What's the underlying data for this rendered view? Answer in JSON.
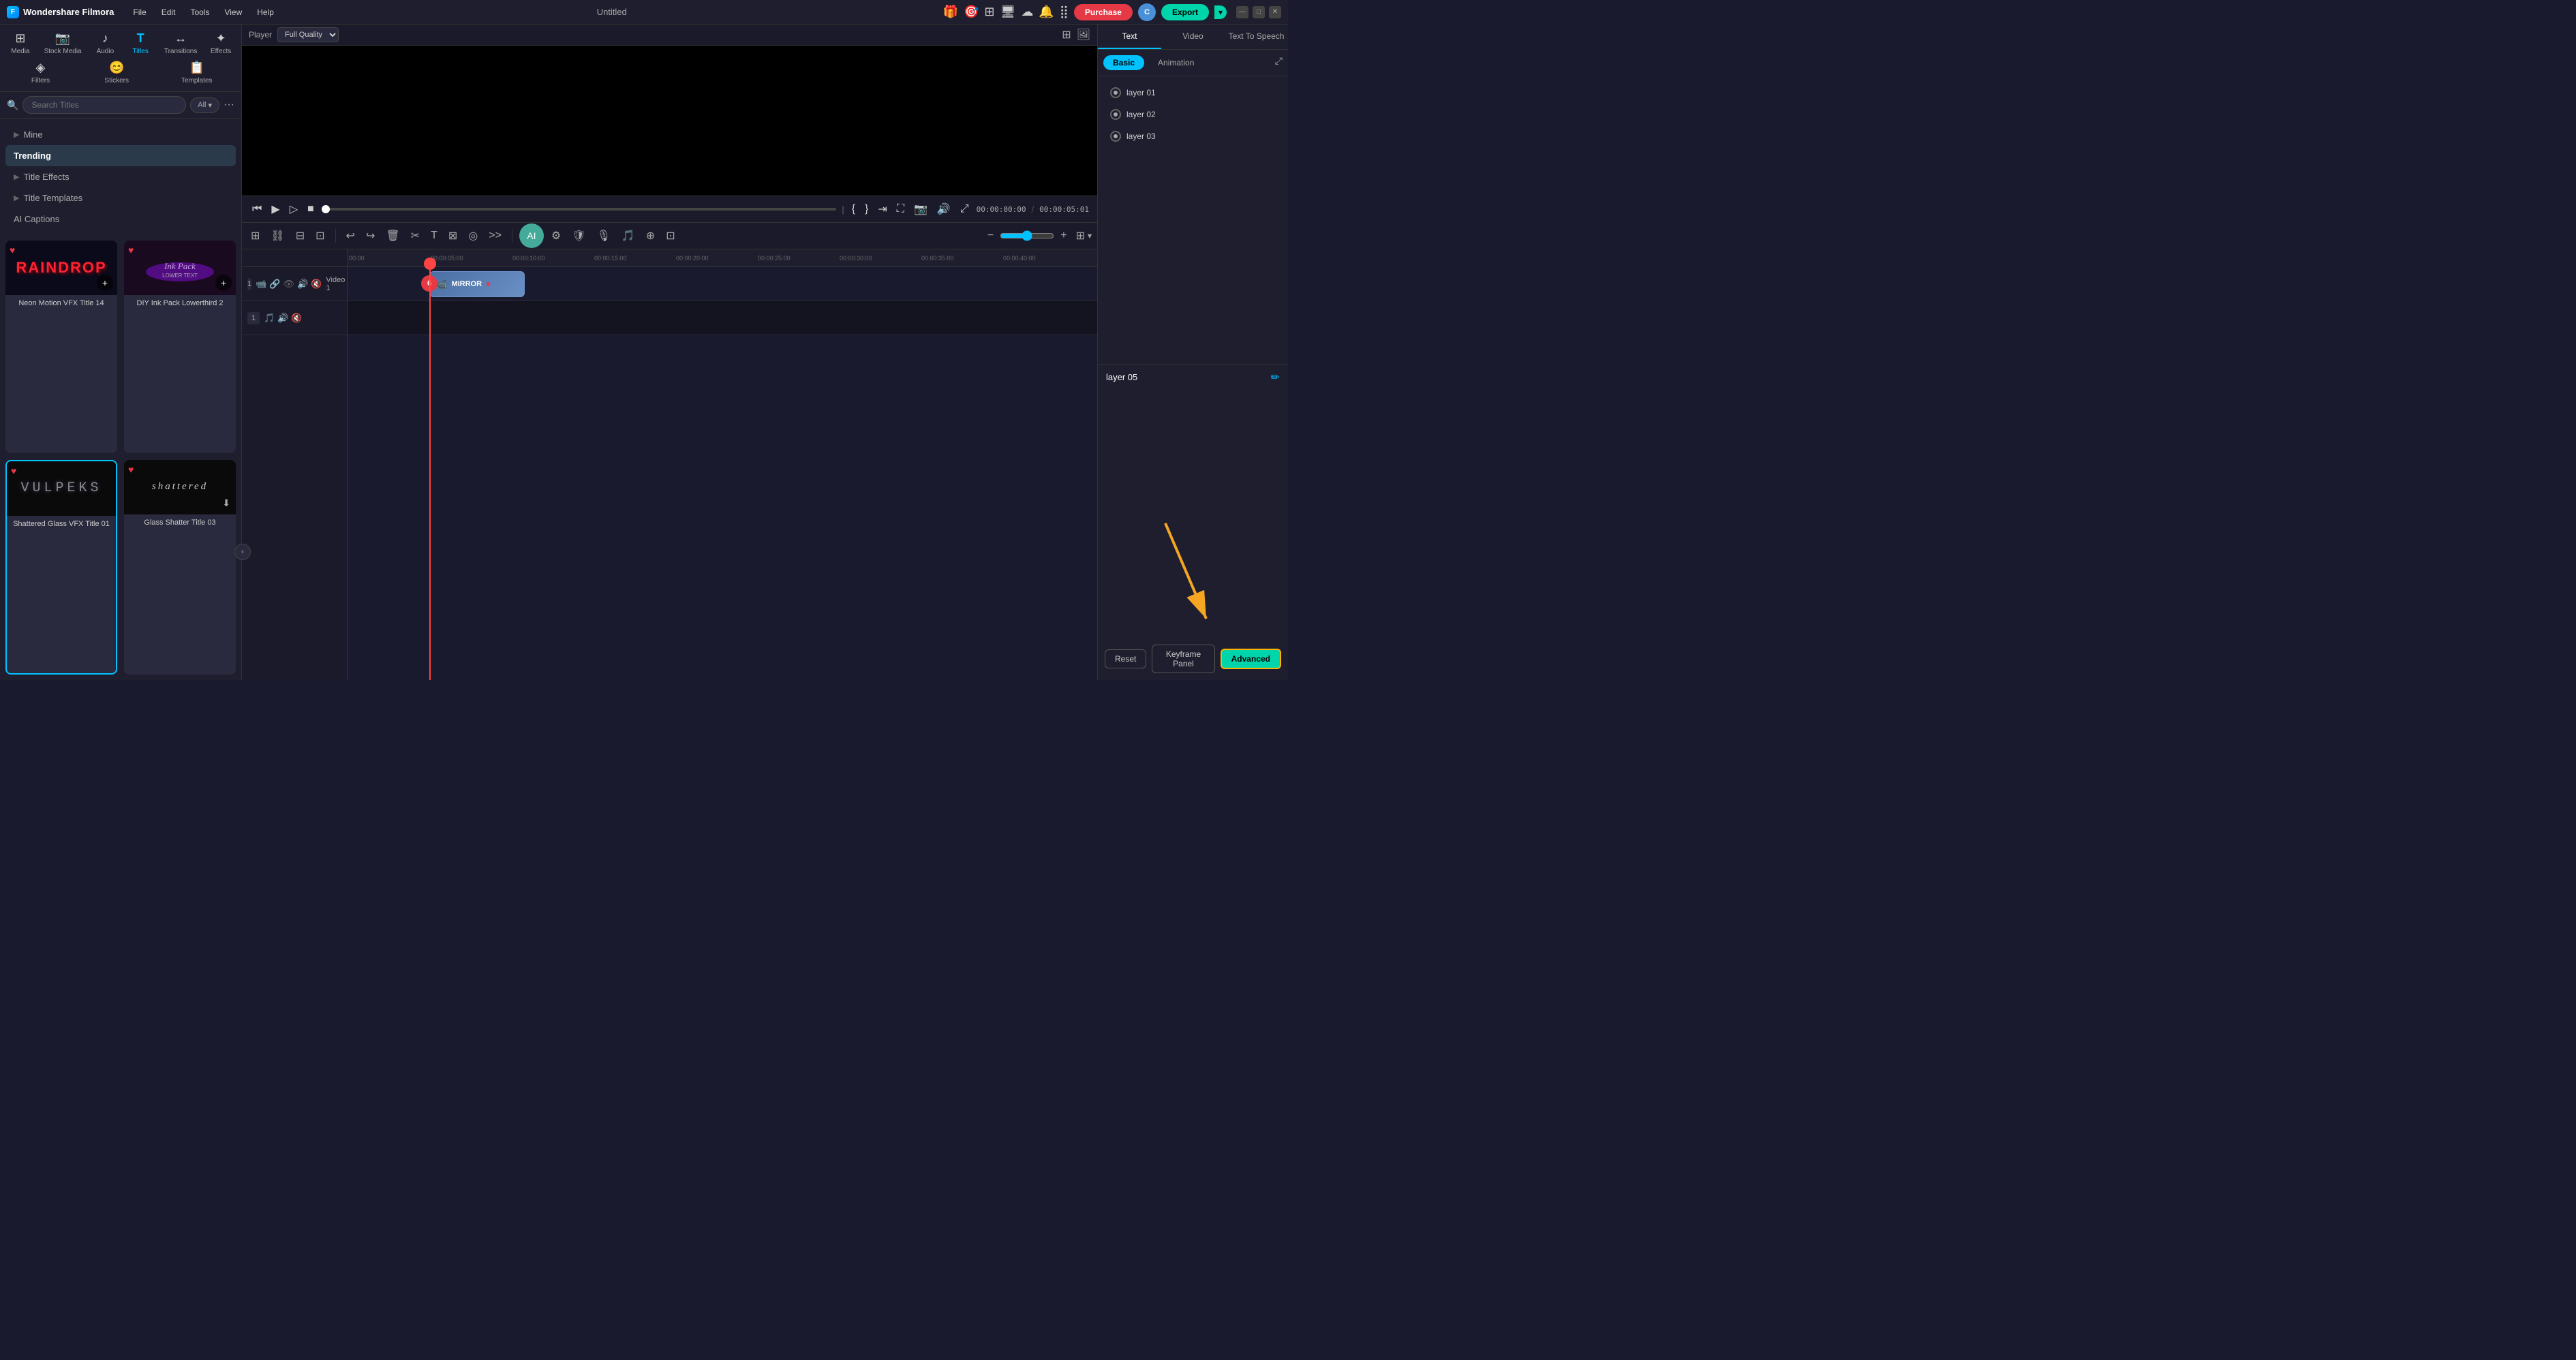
{
  "app": {
    "name": "Wondershare Filmora",
    "project_name": "Untitled"
  },
  "titlebar": {
    "nav_items": [
      "File",
      "Edit",
      "Tools",
      "View",
      "Help"
    ],
    "purchase_label": "Purchase",
    "export_label": "Export",
    "user_initial": "C"
  },
  "media_toolbar": {
    "items": [
      {
        "id": "media",
        "label": "Media",
        "icon": "⊞"
      },
      {
        "id": "stock",
        "label": "Stock Media",
        "icon": "📷"
      },
      {
        "id": "audio",
        "label": "Audio",
        "icon": "♪"
      },
      {
        "id": "titles",
        "label": "Titles",
        "icon": "T"
      },
      {
        "id": "transitions",
        "label": "Transitions",
        "icon": "↔"
      },
      {
        "id": "effects",
        "label": "Effects",
        "icon": "✦"
      },
      {
        "id": "filters",
        "label": "Filters",
        "icon": "◈"
      },
      {
        "id": "stickers",
        "label": "Stickers",
        "icon": "😊"
      },
      {
        "id": "templates",
        "label": "Templates",
        "icon": "📋"
      }
    ],
    "active": "titles"
  },
  "sidebar": {
    "items": [
      {
        "id": "mine",
        "label": "Mine",
        "expandable": true
      },
      {
        "id": "trending",
        "label": "Trending",
        "expandable": false,
        "active": true
      },
      {
        "id": "title-effects",
        "label": "Title Effects",
        "expandable": true
      },
      {
        "id": "title-templates",
        "label": "Title Templates",
        "expandable": true
      },
      {
        "id": "ai-captions",
        "label": "AI Captions",
        "expandable": false
      }
    ]
  },
  "search": {
    "placeholder": "Search Titles",
    "filter_label": "All",
    "icon": "🔍"
  },
  "thumbnails": [
    {
      "id": "thumb1",
      "title": "Neon Motion VFX Title 14",
      "has_heart": true,
      "style": "raindrop",
      "display_text": "RAINDROP",
      "selected": false
    },
    {
      "id": "thumb2",
      "title": "DIY Ink Pack Lowerthird 2",
      "has_heart": true,
      "style": "inkpack",
      "display_text": "Ink Pack",
      "selected": false
    },
    {
      "id": "thumb3",
      "title": "Shattered Glass VFX Title 01",
      "has_heart": true,
      "style": "shattered",
      "display_text": "VULPEKS",
      "selected": true
    },
    {
      "id": "thumb4",
      "title": "Glass Shatter Title 03",
      "has_heart": true,
      "style": "glass",
      "display_text": "shattered",
      "selected": false
    }
  ],
  "player": {
    "label": "Player",
    "quality": "Full Quality",
    "current_time": "00:00:00:00",
    "total_time": "00:00:05:01"
  },
  "right_panel": {
    "tabs": [
      "Text",
      "Video",
      "Text To Speech"
    ],
    "active_tab": "Text",
    "subtabs": [
      "Basic",
      "Animation"
    ],
    "active_subtab": "Basic",
    "layers": [
      {
        "id": "layer-01",
        "label": "layer 01"
      },
      {
        "id": "layer-02",
        "label": "layer 02"
      },
      {
        "id": "layer-03",
        "label": "layer 03"
      }
    ],
    "current_layer": "layer 05",
    "buttons": {
      "reset": "Reset",
      "keyframe": "Keyframe Panel",
      "advanced": "Advanced"
    }
  },
  "timeline": {
    "ruler_marks": [
      "00:00",
      "00:00:05:00",
      "00:00:10:00",
      "00:00:15:00",
      "00:00:20:00",
      "00:00:25:00",
      "00:00:30:00",
      "00:00:35:00",
      "00:00:40:00"
    ],
    "tracks": [
      {
        "id": "video1",
        "label": "Video 1",
        "number": 1
      },
      {
        "id": "audio1",
        "label": "",
        "number": 1
      }
    ],
    "clip": {
      "label": "MIRROR",
      "icon": "📹"
    }
  },
  "colors": {
    "accent": "#00c2ff",
    "accent2": "#00d4aa",
    "danger": "#e63946",
    "bg_dark": "#1a1a2e",
    "bg_panel": "#1e1e2e",
    "border": "#333",
    "advanced_border": "#ffb300"
  }
}
